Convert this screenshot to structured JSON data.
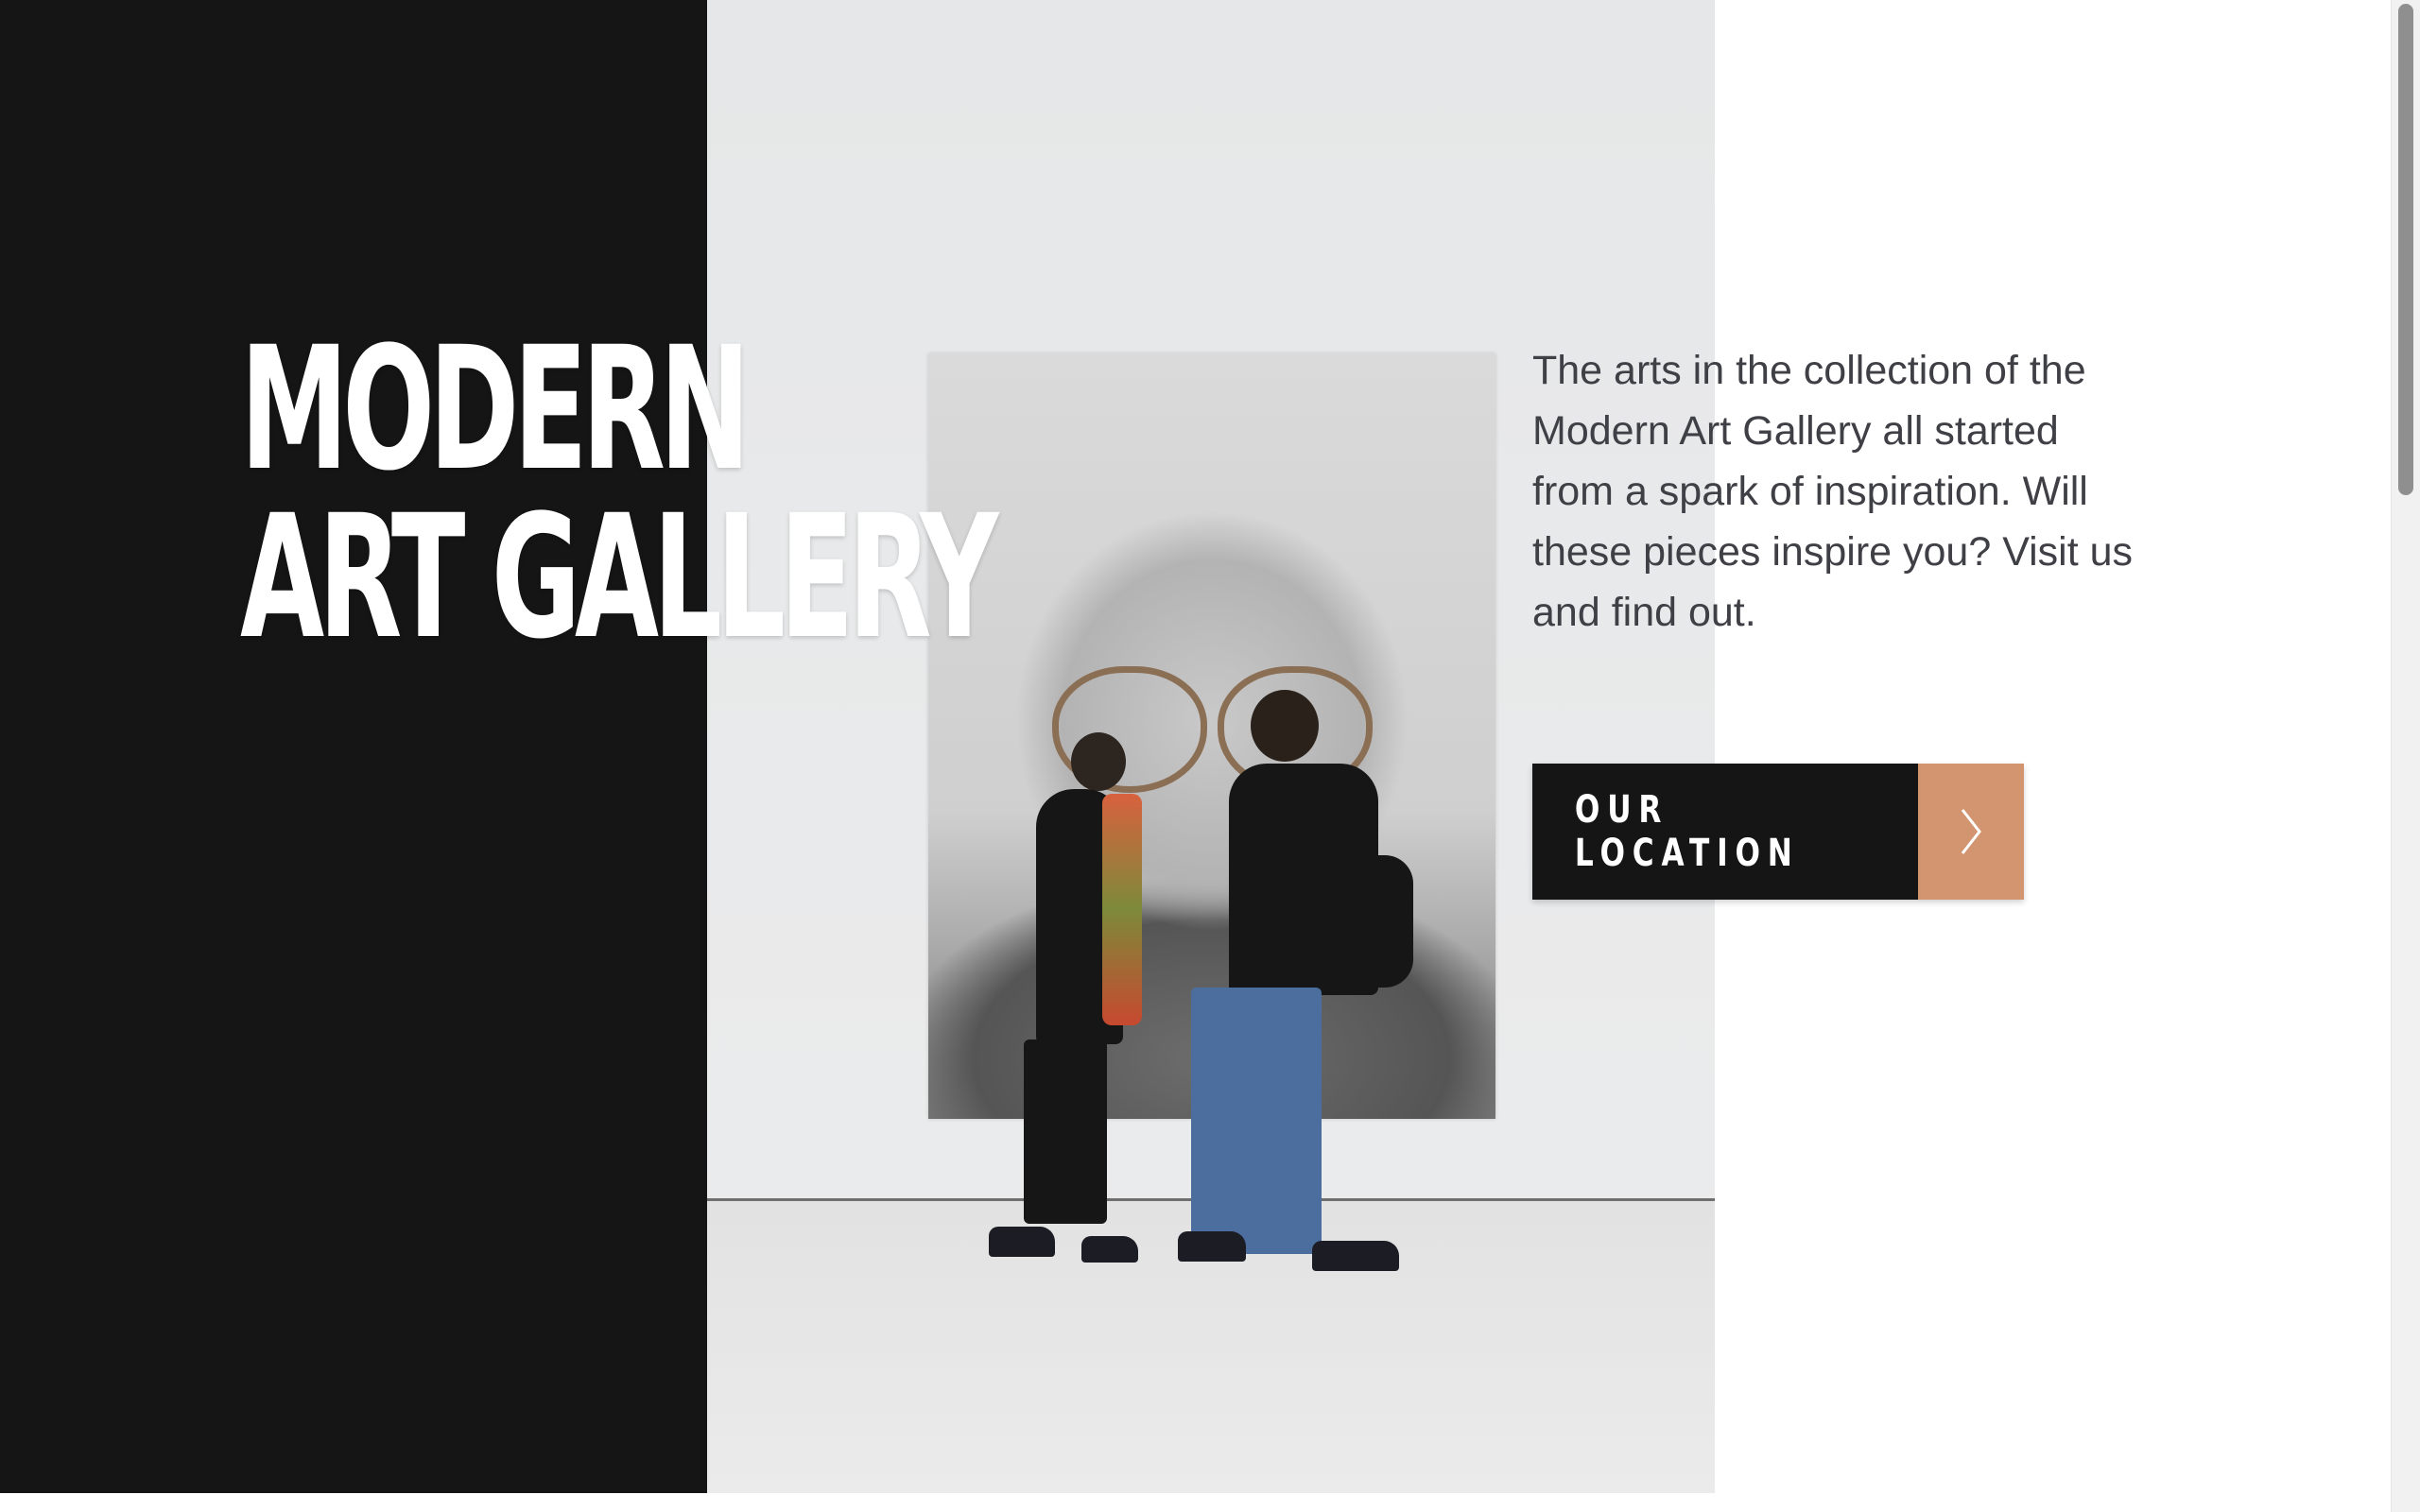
{
  "hero": {
    "title_line_1": "MODERN",
    "title_line_2": "ART GALLERY",
    "intro": "The arts in the collection of the Modern Art Gallery all started from a spark of inspiration. Will these pieces inspire you? Visit us and find out.",
    "cta_label": "OUR LOCATION",
    "cta_icon": "chevron-right-icon"
  },
  "colors": {
    "dark_panel": "#151515",
    "accent": "#d39570",
    "body_text": "#3f3f46",
    "background": "#ffffff"
  }
}
